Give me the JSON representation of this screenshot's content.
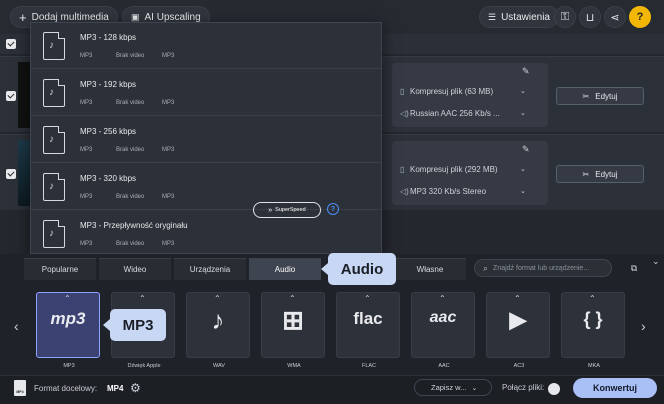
{
  "toolbar": {
    "add_media_label": "Dodaj multimedia",
    "ai_upscaling_label": "AI Upscaling",
    "settings_label": "Ustawienia",
    "help_label": "?"
  },
  "files": [
    {
      "compress": "Kompresuj plik (63 MB)",
      "audio": "Russian AAC 256 Kb/s ...",
      "edit": "Edytuj"
    },
    {
      "compress": "Kompresuj plik (292 MB)",
      "audio": "MP3 320 Kb/s Stereo",
      "edit": "Edytuj"
    }
  ],
  "dropdown": {
    "presets": [
      {
        "title": "MP3 - 128 kbps",
        "col1": "MP3",
        "col2": "Brak video",
        "col3": "MP3"
      },
      {
        "title": "MP3 - 192 kbps",
        "col1": "MP3",
        "col2": "Brak video",
        "col3": "MP3"
      },
      {
        "title": "MP3 - 256 kbps",
        "col1": "MP3",
        "col2": "Brak video",
        "col3": "MP3"
      },
      {
        "title": "MP3 - 320 kbps",
        "col1": "MP3",
        "col2": "Brak video",
        "col3": "MP3"
      },
      {
        "title": "MP3 - Przepływność oryginału",
        "col1": "MP3",
        "col2": "Brak video",
        "col3": "MP3"
      }
    ],
    "superspeed_label": "SuperSpeed",
    "info_label": "?"
  },
  "format_tabs": [
    {
      "label": "Popularne"
    },
    {
      "label": "Wideo"
    },
    {
      "label": "Urządzenia"
    },
    {
      "label": "Audio",
      "active": true
    },
    {
      "label": "Własne"
    }
  ],
  "tooltips": {
    "audio": "Audio",
    "mp3": "MP3"
  },
  "search": {
    "placeholder": "Znajdź format lub urządzenie..."
  },
  "formats": [
    {
      "label": "MP3",
      "glyph": "mp3",
      "selected": true
    },
    {
      "label": "Dźwięk Apple",
      "glyph": ""
    },
    {
      "label": "WAV",
      "glyph": "♪"
    },
    {
      "label": "WMA",
      "glyph": "⊞"
    },
    {
      "label": "FLAC",
      "glyph": "flac"
    },
    {
      "label": "AAC",
      "glyph": "aac"
    },
    {
      "label": "AC3",
      "glyph": "▶"
    },
    {
      "label": "MKA",
      "glyph": "{ }"
    }
  ],
  "footer": {
    "file_badge": "MP4",
    "target_label": "Format docelowy:",
    "target_value": "MP4",
    "save_to_label": "Zapisz w...",
    "merge_label": "Połącz pliki:",
    "convert_label": "Konwertuj"
  },
  "colors": {
    "accent": "#a9c0f6",
    "tooltip": "#c8d7f4",
    "help": "#f2b705",
    "selected_format_border": "#8ca3ff"
  }
}
